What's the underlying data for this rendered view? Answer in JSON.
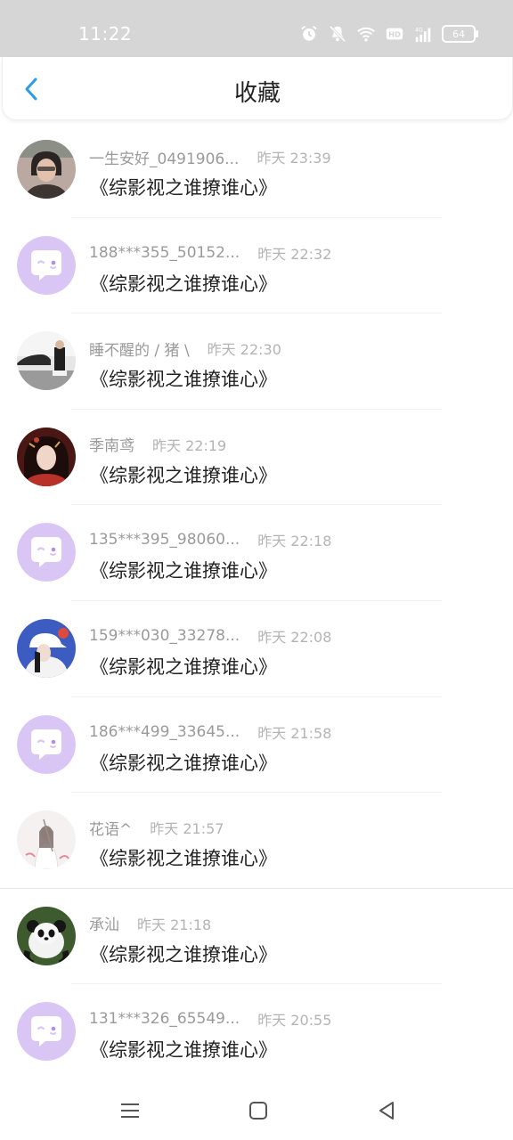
{
  "status_bar": {
    "time": "11:22",
    "icons": [
      "alarm-icon",
      "mute-icon",
      "wifi-icon",
      "hd-icon",
      "4g-signal-icon"
    ],
    "battery": "64"
  },
  "header": {
    "title": "收藏",
    "back_icon": "chevron-left-icon"
  },
  "items": [
    {
      "name": "一生安好_0491906...",
      "time": "昨天 23:39",
      "title": "《综影视之谁撩谁心》",
      "avatar": "photo-woman"
    },
    {
      "name": "188***355_50152...",
      "time": "昨天 22:32",
      "title": "《综影视之谁撩谁心》",
      "avatar": "default-chat"
    },
    {
      "name": "睡不醒的 / 猪 \\",
      "time": "昨天 22:30",
      "title": "《综影视之谁撩谁心》",
      "avatar": "photo-street"
    },
    {
      "name": "季南鸢",
      "time": "昨天 22:19",
      "title": "《综影视之谁撩谁心》",
      "avatar": "photo-costume"
    },
    {
      "name": "135***395_98060...",
      "time": "昨天 22:18",
      "title": "《综影视之谁撩谁心》",
      "avatar": "default-chat"
    },
    {
      "name": "159***030_33278...",
      "time": "昨天 22:08",
      "title": "《综影视之谁撩谁心》",
      "avatar": "photo-cap-girl"
    },
    {
      "name": "186***499_33645...",
      "time": "昨天 21:58",
      "title": "《综影视之谁撩谁心》",
      "avatar": "default-chat"
    },
    {
      "name": "花语^",
      "time": "昨天 21:57",
      "title": "《综影视之谁撩谁心》",
      "avatar": "photo-white-hanfu"
    },
    {
      "name": "承汕",
      "time": "昨天 21:18",
      "title": "《综影视之谁撩谁心》",
      "avatar": "photo-panda"
    },
    {
      "name": "131***326_65549...",
      "time": "昨天 20:55",
      "title": "《综影视之谁撩谁心》",
      "avatar": "default-chat"
    }
  ],
  "nav_bar": {
    "icons": [
      "menu-icon",
      "home-square-icon",
      "back-triangle-icon"
    ]
  },
  "colors": {
    "status_bar_bg": "#d6d6d6",
    "accent_blue": "#2b9be6",
    "default_avatar_bg": "#d9c6f4",
    "username_gray": "#9a9a9a",
    "time_gray": "#b4b4b4",
    "title_text": "#222222"
  }
}
